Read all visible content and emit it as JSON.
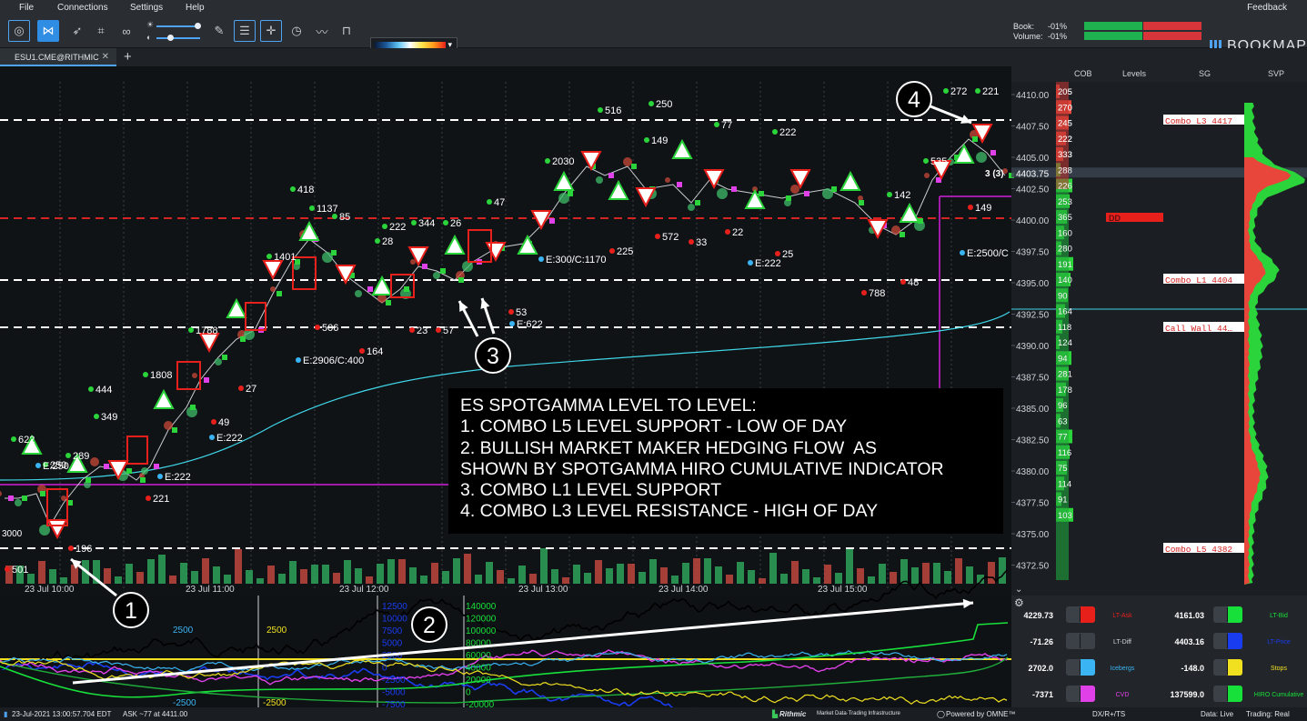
{
  "menu": {
    "items": [
      "File",
      "Connections",
      "Settings",
      "Help"
    ],
    "feedback": "Feedback"
  },
  "toolbar": {
    "book_label": "Book:",
    "book_value": "-01%",
    "volume_label": "Volume:",
    "volume_value": "-01%",
    "brand": "BOOKMAP",
    "heatmap_dropdown": "▾"
  },
  "tab": {
    "label": "ESU1.CME@RITHMIC",
    "close": "✕",
    "add": "+"
  },
  "columns": {
    "cob": "COB",
    "levels": "Levels",
    "sg": "SG",
    "svp": "SVP"
  },
  "price_axis": {
    "prices": [
      "4410.00",
      "4407.50",
      "4405.00",
      "4402.50",
      "4400.00",
      "4397.50",
      "4395.00",
      "4392.50",
      "4390.00",
      "4387.50",
      "4385.00",
      "4382.50",
      "4380.00",
      "4377.50",
      "4375.00",
      "4372.50"
    ],
    "current_price": "4403.75"
  },
  "cob_values": [
    "205",
    "270",
    "245",
    "222",
    "333",
    "288",
    "226",
    "253",
    "365",
    "160",
    "280",
    "191",
    "140",
    "90",
    "164",
    "118",
    "124",
    "94",
    "281",
    "178",
    "96",
    "63",
    "77",
    "116",
    "75",
    "114",
    "91",
    "103"
  ],
  "sg_levels": [
    "Combo L3 4417",
    "Combo L1 4404",
    "Call Wall 44…",
    "Combo L5 4382"
  ],
  "levels_dd": "DD",
  "time_axis": [
    "23 Jul 10:00",
    "23 Jul 11:00",
    "23 Jul 12:00",
    "23 Jul 13:00",
    "23 Jul 14:00",
    "23 Jul 15:00"
  ],
  "markers": {
    "green": [
      "622",
      "289",
      "250",
      "349",
      "444",
      "1808",
      "1788",
      "418",
      "1401",
      "85",
      "1137",
      "28",
      "222",
      "344",
      "26",
      "47",
      "2030",
      "516",
      "149",
      "250",
      "77",
      "222",
      "142",
      "535",
      "272",
      "221"
    ],
    "red": [
      "501",
      "196",
      "221",
      "49",
      "27",
      "506",
      "164",
      "23",
      "57",
      "53",
      "225",
      "572",
      "33",
      "22",
      "25",
      "788",
      "48",
      "149"
    ],
    "blue": [
      "E:250",
      "E:222",
      "E:222",
      "E:2906/C:400",
      "E:622",
      "E:300/C:1170",
      "E:222",
      "E:2500/C"
    ],
    "left_edge": [
      "3000"
    ],
    "right_edge": "3 (3)"
  },
  "callouts": [
    "1",
    "2",
    "3",
    "4"
  ],
  "annotation": {
    "lines": [
      "ES SPOTGAMMA LEVEL TO LEVEL:",
      "1. COMBO L5 LEVEL SUPPORT - LOW OF DAY",
      "2. BULLISH MARKET MAKER HEDGING FLOW  AS",
      "SHOWN BY SPOTGAMMA HIRO CUMULATIVE INDICATOR",
      "3. COMBO L1 LEVEL SUPPORT",
      "4. COMBO L3 LEVEL RESISTANCE - HIGH OF DAY"
    ]
  },
  "sub_axis": {
    "left_labels": [
      "2500",
      "-2500"
    ],
    "mid_labels": [
      "2500",
      "-2500"
    ],
    "a_labels": [
      "12500",
      "10000",
      "7500",
      "5000",
      "2500",
      "0",
      "-2500",
      "-5000",
      "-7500"
    ],
    "b_labels": [
      "140000",
      "120000",
      "100000",
      "80000",
      "60000",
      "40000",
      "20000",
      "0",
      "-20000"
    ]
  },
  "indicators": [
    {
      "left_value": "4229.73",
      "left_color": "#e8201c",
      "left_name": "LT-Ask",
      "right_value": "4161.03",
      "right_color": "#18e03a",
      "right_name": "LT-Bid"
    },
    {
      "left_value": "-71.26",
      "left_color": "#3c4147",
      "left_name": "LT-Diff",
      "right_value": "4403.16",
      "right_color": "#1a3cf0",
      "right_name": "LT-Price"
    },
    {
      "left_value": "2702.0",
      "left_color": "#3ab4f2",
      "left_name": "Icebergs",
      "right_value": "-148.0",
      "right_color": "#f0e020",
      "right_name": "Stops"
    },
    {
      "left_value": "-7371",
      "left_color": "#e040e8",
      "left_name": "CVD",
      "right_value": "137599.0",
      "right_color": "#18e03a",
      "right_name": "HIRO Cumulative"
    }
  ],
  "status": {
    "datetime": "23-Jul-2021 13:00:57.704 EDT",
    "ask": "ASK ~77 at 4411.00",
    "rithmic": "Rithmic",
    "rithmic_tag": "Market Data·Trading Infrastructure",
    "powered": "Powered by OMNE™",
    "mode": "DX/R+/TS",
    "data": "Data: Live",
    "trading": "Trading: Real"
  },
  "colors": {
    "accent": "#2f8de4",
    "bid_green": "#18e03a",
    "ask_red": "#e8201c",
    "vwap": "#3fd6e8",
    "level_magenta": "#d21ed8"
  }
}
